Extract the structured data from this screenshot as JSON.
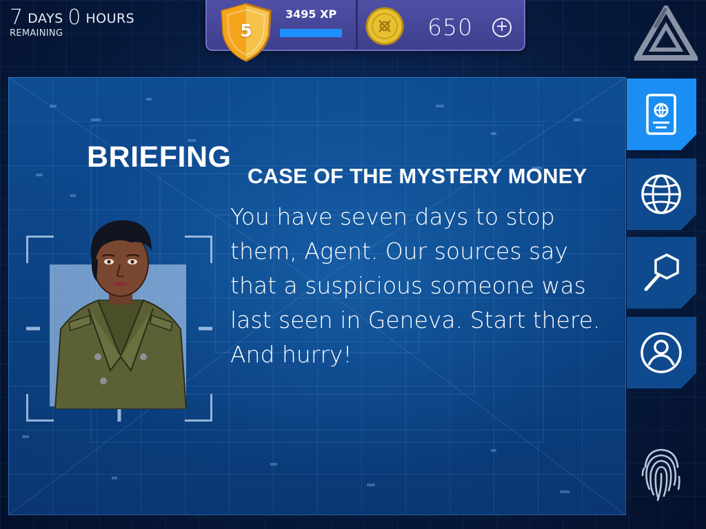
{
  "timer": {
    "days_number": "7",
    "days_label": "DAYS",
    "hours_number": "0",
    "hours_label": "HOURS",
    "remaining_label": "REMAINING"
  },
  "hud": {
    "level": "5",
    "xp_label": "3495 XP",
    "xp_progress_fraction": 1.0,
    "coins": "650",
    "add_coins_symbol": "+"
  },
  "briefing": {
    "heading": "BRIEFING",
    "case_title": "CASE OF THE MYSTERY MONEY",
    "message": "You have seven days to stop them, Agent. Our sources say that a suspicious someone was last seen in Geneva. Start there. And hurry!"
  },
  "side_tabs": [
    {
      "icon": "passport-icon",
      "active": true
    },
    {
      "icon": "globe-icon",
      "active": false
    },
    {
      "icon": "magnifier-icon",
      "active": false
    },
    {
      "icon": "profile-icon",
      "active": false
    }
  ],
  "colors": {
    "accent_blue": "#1a8ef2",
    "hud_purple": "#4f4fa6",
    "shield_gold": "#f4a51c",
    "coin_gold": "#e8c130"
  }
}
